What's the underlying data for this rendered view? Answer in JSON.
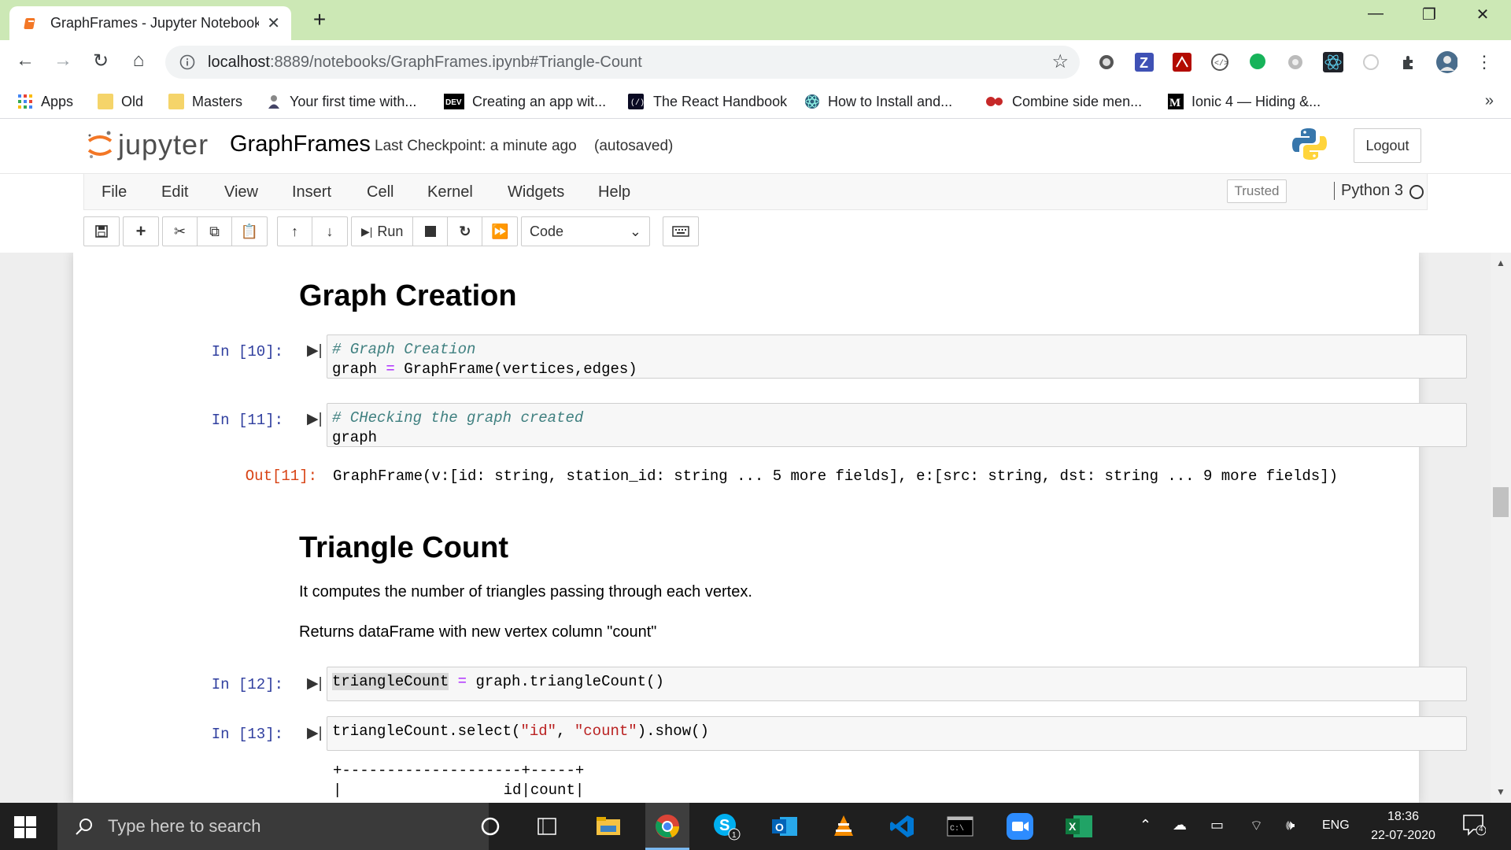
{
  "browser": {
    "tab_title": "GraphFrames - Jupyter Notebook",
    "url_host": "localhost",
    "url_rest": ":8889/notebooks/GraphFrames.ipynb#Triangle-Count",
    "bookmarks": [
      "Apps",
      "Old",
      "Masters",
      "Your first time with...",
      "Creating an app wit...",
      "The React Handbook",
      "How to Install and...",
      "Combine side men...",
      "Ionic 4 — Hiding &..."
    ]
  },
  "jupyter": {
    "logo_text": "jupyter",
    "notebook_name": "GraphFrames",
    "checkpoint": "Last Checkpoint: a minute ago",
    "autosaved": "(autosaved)",
    "logout": "Logout",
    "menu": [
      "File",
      "Edit",
      "View",
      "Insert",
      "Cell",
      "Kernel",
      "Widgets",
      "Help"
    ],
    "trusted": "Trusted",
    "kernel": "Python 3",
    "run_label": "Run",
    "cell_type": "Code"
  },
  "cells": {
    "h_graph_creation": "Graph Creation",
    "in10_prompt": "In [10]:",
    "in10_comment": "# Graph Creation",
    "in10_code_a": "graph ",
    "in10_code_eq": "=",
    "in10_code_b": " GraphFrame(vertices,edges)",
    "in11_prompt": "In [11]:",
    "in11_comment": "# CHecking the graph created",
    "in11_code": "graph",
    "out11_prompt": "Out[11]:",
    "out11_text": "GraphFrame(v:[id: string, station_id: string ... 5 more fields], e:[src: string, dst: string ... 9 more fields])",
    "h_triangle_count": "Triangle Count",
    "tc_desc1": "It computes the number of triangles passing through each vertex.",
    "tc_desc2": "Returns dataFrame with new vertex column \"count\"",
    "in12_prompt": "In [12]:",
    "in12_var": "triangleCount",
    "in12_eq": "=",
    "in12_rest": " graph.triangleCount()",
    "in13_prompt": "In [13]:",
    "in13_a": "triangleCount.select(",
    "in13_s1": "\"id\"",
    "in13_comma": ", ",
    "in13_s2": "\"count\"",
    "in13_b": ").show()",
    "out13_line1": "+--------------------+-----+",
    "out13_line2": "|                  id|count|"
  },
  "taskbar": {
    "search_placeholder": "Type here to search",
    "lang": "ENG",
    "time": "18:36",
    "date": "22-07-2020",
    "notifications": "4"
  }
}
